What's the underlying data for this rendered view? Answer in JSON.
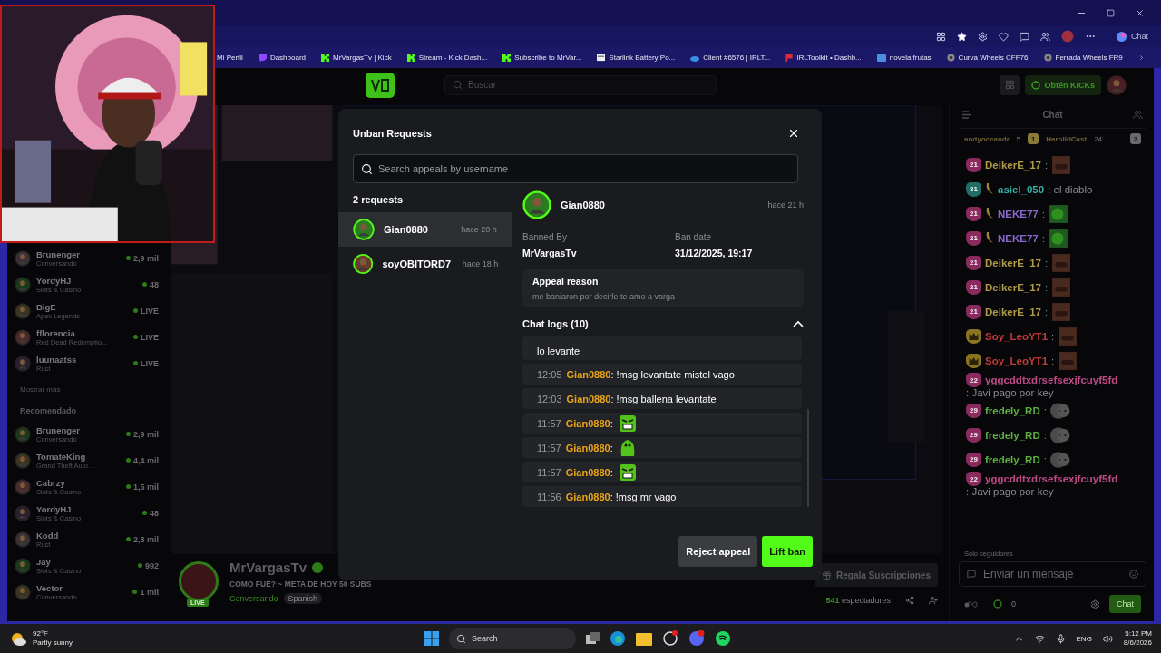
{
  "browser": {
    "copilot_label": "Chat",
    "bookmarks": [
      {
        "label": "Mi Perfil",
        "kind": "none"
      },
      {
        "label": "Dashboard",
        "kind": "twitch"
      },
      {
        "label": "MrVargasTv | Kick",
        "kind": "kick"
      },
      {
        "label": "Stream - Kick Dash...",
        "kind": "kick"
      },
      {
        "label": "Subscribe to MrVar...",
        "kind": "kick"
      },
      {
        "label": "Starlink Battery Po...",
        "kind": "page"
      },
      {
        "label": "Client #6576 | IRLT...",
        "kind": "cloud"
      },
      {
        "label": "IRLToolkit • Dashb...",
        "kind": "irl"
      },
      {
        "label": "novela frutas",
        "kind": "folder"
      },
      {
        "label": "Curva Wheels CFF76",
        "kind": "wheel"
      },
      {
        "label": "Ferrada Wheels FR9",
        "kind": "wheel"
      }
    ]
  },
  "header": {
    "search_placeholder": "Buscar",
    "kicks_label": "Obtén KICKs"
  },
  "sidebar": {
    "channels": [
      {
        "name": "Brunenger",
        "category": "Conversando",
        "viewers": "2,9 mil"
      },
      {
        "name": "YordyHJ",
        "category": "Slots & Casino",
        "viewers": "48"
      },
      {
        "name": "BigE",
        "category": "Apex Legends",
        "viewers": "LIVE"
      },
      {
        "name": "fflorencia",
        "category": "Red Dead Redemptio...",
        "viewers": "LIVE"
      },
      {
        "name": "luunaatss",
        "category": "Rust",
        "viewers": "LIVE"
      }
    ],
    "show_more": "Mostrar más",
    "recommended_title": "Recomendado",
    "recommended": [
      {
        "name": "Brunenger",
        "category": "Conversando",
        "viewers": "2,9 mil"
      },
      {
        "name": "TomateKing",
        "category": "Grand Theft Auto ...",
        "viewers": "4,4 mil"
      },
      {
        "name": "Cabrzy",
        "category": "Slots & Casino",
        "viewers": "1,5 mil"
      },
      {
        "name": "YordyHJ",
        "category": "Slots & Casino",
        "viewers": "48"
      },
      {
        "name": "Kodd",
        "category": "Rust",
        "viewers": "2,8 mil"
      },
      {
        "name": "Jay",
        "category": "Slots & Casino",
        "viewers": "992"
      },
      {
        "name": "Vector",
        "category": "Conversando",
        "viewers": "1 mil"
      }
    ]
  },
  "stream": {
    "live_badge": "LIVE",
    "channel": "MrVargasTv",
    "title": "COMO FUE? ~ META DE HOY 50 SUBS",
    "category": "Conversando",
    "language": "Spanish",
    "viewers": "541",
    "viewers_label": "espectadores",
    "gift_label": "Regala Suscripciones"
  },
  "chat": {
    "title": "Chat",
    "pinned": [
      {
        "user": "andyoceandr",
        "count": "5"
      },
      {
        "user": "HarolldCast",
        "count": "24",
        "rank": "1"
      }
    ],
    "pinned_more": "2",
    "messages": [
      {
        "badge": {
          "kind": "sub",
          "label": "21"
        },
        "banana": false,
        "user": "DeikerE_17",
        "color": "#b09a48",
        "kind": "face",
        "text": ":"
      },
      {
        "badge": {
          "kind": "veteran",
          "label": "31"
        },
        "banana": true,
        "user": "asiel_050",
        "color": "#35b0a8",
        "kind": "text",
        "text": ": el diablo"
      },
      {
        "badge": {
          "kind": "sub",
          "label": "21"
        },
        "banana": true,
        "user": "NEKE77",
        "color": "#8a68d0",
        "kind": "green",
        "text": ":"
      },
      {
        "badge": {
          "kind": "sub",
          "label": "21"
        },
        "banana": true,
        "user": "NEKE77",
        "color": "#8a68d0",
        "kind": "green",
        "text": ":"
      },
      {
        "badge": {
          "kind": "sub",
          "label": "21"
        },
        "banana": false,
        "user": "DeikerE_17",
        "color": "#b09a48",
        "kind": "face",
        "text": ":"
      },
      {
        "badge": {
          "kind": "sub",
          "label": "21"
        },
        "banana": false,
        "user": "DeikerE_17",
        "color": "#b09a48",
        "kind": "face",
        "text": ":"
      },
      {
        "badge": {
          "kind": "sub",
          "label": "21"
        },
        "banana": false,
        "user": "DeikerE_17",
        "color": "#b09a48",
        "kind": "face",
        "text": ":"
      },
      {
        "badge": {
          "kind": "crown"
        },
        "banana": false,
        "user": "Soy_LeoYT1",
        "color": "#c03a3a",
        "kind": "face",
        "text": ":"
      },
      {
        "badge": {
          "kind": "crown"
        },
        "banana": false,
        "user": "Soy_LeoYT1",
        "color": "#c03a3a",
        "kind": "face",
        "text": ":"
      },
      {
        "badge": {
          "kind": "sub",
          "label": "22"
        },
        "banana": false,
        "user": "yggcddtxdrsefsexjfcuyf5fd",
        "color": "#c04a88",
        "kind": "text",
        "text": ": Javi pago por key"
      },
      {
        "badge": {
          "kind": "sub",
          "label": "29"
        },
        "banana": false,
        "user": "fredely_RD",
        "color": "#5cb040",
        "kind": "ghost",
        "text": ":"
      },
      {
        "badge": {
          "kind": "sub",
          "label": "29"
        },
        "banana": false,
        "user": "fredely_RD",
        "color": "#5cb040",
        "kind": "ghost",
        "text": ":"
      },
      {
        "badge": {
          "kind": "sub",
          "label": "29"
        },
        "banana": false,
        "user": "fredely_RD",
        "color": "#5cb040",
        "kind": "ghost",
        "text": ":"
      },
      {
        "badge": {
          "kind": "sub",
          "label": "22"
        },
        "banana": false,
        "user": "yggcddtxdrsefsexjfcuyf5fd",
        "color": "#c04a88",
        "kind": "text",
        "text": ": Javi pago por key"
      }
    ],
    "followers_only": "Solo seguidores",
    "input_placeholder": "Enviar un mensaje",
    "points": "0",
    "send_label": "Chat"
  },
  "modal": {
    "title": "Unban Requests",
    "search_placeholder": "Search appeals by username",
    "count_label": "2 requests",
    "requests": [
      {
        "user": "Gian0880",
        "time": "hace 20 h",
        "selected": true
      },
      {
        "user": "soyOBITORD7",
        "time": "hace 18 h",
        "selected": false
      }
    ],
    "detail": {
      "user": "Gian0880",
      "time": "hace 21 h",
      "banned_by_label": "Banned By",
      "banned_by": "MrVargasTv",
      "ban_date_label": "Ban date",
      "ban_date": "31/12/2025, 19:17",
      "reason_label": "Appeal reason",
      "reason": "me baniaron por decirle te amo a varga",
      "logs_label": "Chat logs (10)",
      "logs_expanded": true,
      "logs": [
        {
          "kind": "continuation",
          "text": "lo levante"
        },
        {
          "kind": "text",
          "time": "12:05",
          "user": "Gian0880",
          "text": ": !msg levantate mistel vago"
        },
        {
          "kind": "text",
          "time": "12:03",
          "user": "Gian0880",
          "text": ": !msg ballena levantate"
        },
        {
          "kind": "angry",
          "time": "11:57",
          "user": "Gian0880",
          "text": ":"
        },
        {
          "kind": "blob",
          "time": "11:57",
          "user": "Gian0880",
          "text": ":"
        },
        {
          "kind": "angry",
          "time": "11:57",
          "user": "Gian0880",
          "text": ":"
        },
        {
          "kind": "text",
          "time": "11:56",
          "user": "Gian0880",
          "text": ": !msg mr vago"
        }
      ]
    },
    "reject_label": "Reject appeal",
    "lift_label": "Lift ban"
  },
  "taskbar": {
    "temperature": "92°F",
    "weather": "Partly sunny",
    "search_label": "Search",
    "language": "ENG",
    "time": "5:12 PM",
    "date": "8/6/2026"
  }
}
